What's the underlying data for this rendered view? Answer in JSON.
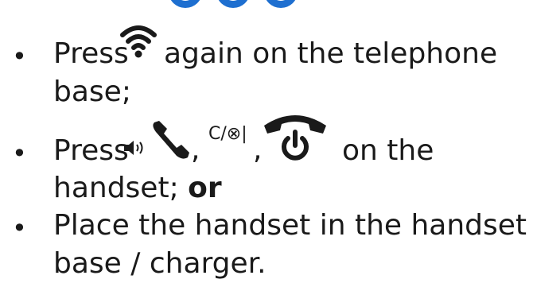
{
  "items": [
    {
      "line1_pre": "Press",
      "line1_post": "again on the telephone",
      "line2": "base;"
    },
    {
      "line1_pre": "Press",
      "key_clear": "C/⊗|",
      "comma": ",",
      "line1_post": "on the",
      "line2_pre": "handset;",
      "line2_bold": "or"
    },
    {
      "line1": "Place the handset in the handset",
      "line2": "base / charger."
    }
  ],
  "bullet": "•",
  "colors": {
    "text": "#1a1a1a",
    "accent": "#1e6fd0"
  },
  "icons": [
    "wifi-icon",
    "speaker-icon",
    "talk-handset-icon",
    "end-call-icon"
  ]
}
